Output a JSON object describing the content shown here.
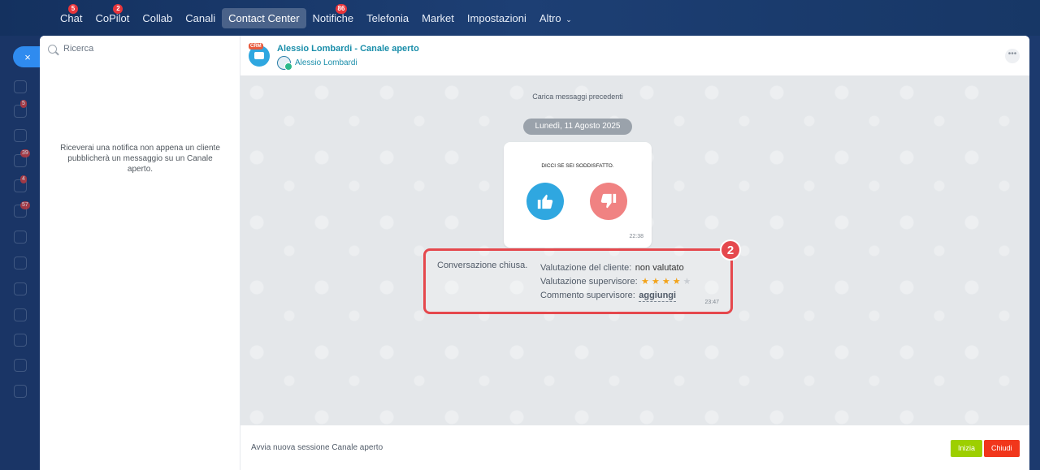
{
  "topnav": {
    "items": [
      {
        "label": "Chat",
        "badge": "5"
      },
      {
        "label": "CoPilot",
        "badge": "2"
      },
      {
        "label": "Collab",
        "badge": ""
      },
      {
        "label": "Canali",
        "badge": ""
      },
      {
        "label": "Contact Center",
        "badge": "",
        "active": true
      },
      {
        "label": "Notifiche",
        "badge": "86"
      },
      {
        "label": "Telefonia",
        "badge": ""
      },
      {
        "label": "Market",
        "badge": ""
      },
      {
        "label": "Impostazioni",
        "badge": ""
      },
      {
        "label": "Altro",
        "badge": ""
      }
    ]
  },
  "left_rail": {
    "close_glyph": "×",
    "badges": [
      "5",
      "39",
      "4",
      "57"
    ]
  },
  "list": {
    "search_placeholder": "Ricerca",
    "empty_note": "Riceverai una notifica non appena un cliente pubblicherà un messaggio su un Canale aperto."
  },
  "chat": {
    "crm_tag": "CRM",
    "title": "Alessio Lombardi - Canale aperto",
    "subtitle": "Alessio Lombardi",
    "load_prev": "Carica messaggi precedenti",
    "date": "Lunedì, 11 Agosto 2025",
    "rating_card": {
      "question": "DICCI SE SEI SODDISFATTO.",
      "time": "22:38"
    },
    "closed": {
      "status": "Conversazione chiusa.",
      "client_rating_label": "Valutazione del cliente:",
      "client_rating_value": "non valutato",
      "supervisor_rating_label": "Valutazione supervisore:",
      "supervisor_stars": 4,
      "supervisor_stars_max": 5,
      "supervisor_comment_label": "Commento supervisore:",
      "supervisor_comment_link": "aggiungi",
      "time": "23:47"
    },
    "annotation_number": "2",
    "footer": {
      "text": "Avvia nuova sessione Canale aperto",
      "start_label": "Inizia",
      "close_label": "Chiudi"
    }
  },
  "colors": {
    "accent_link": "#1a8eaa",
    "highlight": "#e5484d",
    "start_button": "#9dcf00",
    "close_button": "#f1361b",
    "star": "#f2a31a"
  }
}
